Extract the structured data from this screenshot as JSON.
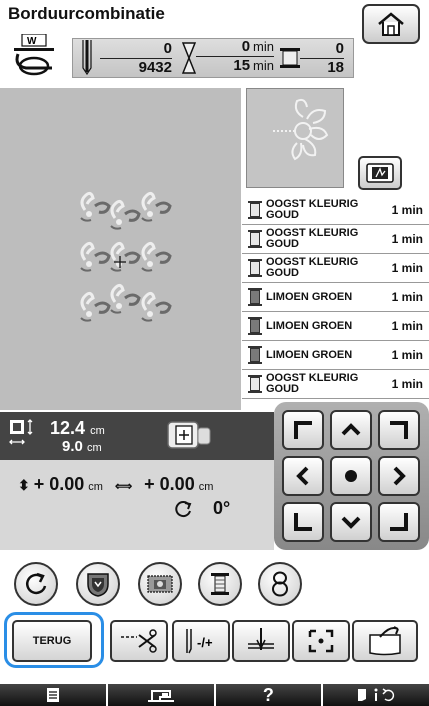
{
  "header": {
    "title": "Borduurcombinatie",
    "stitch_count": {
      "current": "0",
      "total": "9432"
    },
    "time": {
      "current": "0",
      "total": "15",
      "unit": "min"
    },
    "color_change": {
      "current": "0",
      "total": "18"
    }
  },
  "threads": [
    {
      "name": "OOGST KLEURIG GOUD",
      "time": "1 min",
      "color": "#e8e8e8"
    },
    {
      "name": "OOGST KLEURIG GOUD",
      "time": "1 min",
      "color": "#e8e8e8"
    },
    {
      "name": "OOGST KLEURIG GOUD",
      "time": "1 min",
      "color": "#e8e8e8"
    },
    {
      "name": "LIMOEN GROEN",
      "time": "1 min",
      "color": "#7a7a7a"
    },
    {
      "name": "LIMOEN GROEN",
      "time": "1 min",
      "color": "#7a7a7a"
    },
    {
      "name": "LIMOEN GROEN",
      "time": "1 min",
      "color": "#7a7a7a"
    },
    {
      "name": "OOGST KLEURIG GOUD",
      "time": "1 min",
      "color": "#e8e8e8"
    }
  ],
  "size": {
    "width": "12.4",
    "height": "9.0",
    "unit": "cm"
  },
  "offset": {
    "vertical": "+ 0.00",
    "horizontal": "+ 0.00",
    "unit": "cm"
  },
  "rotation": {
    "angle": "0°"
  },
  "buttons": {
    "back": "TERUG"
  },
  "icons": {
    "home": "home-icon",
    "view": "zoom-view-icon",
    "rotate": "rotate-icon",
    "border": "border-shield-icon",
    "density": "density-icon",
    "thread": "thread-spool-icon",
    "repeat": "repeat-8-icon",
    "cut": "thread-cut-icon",
    "tension": "tension-icon",
    "needle": "needle-position-icon",
    "trial": "trial-frame-icon",
    "pocket": "memory-pocket-icon"
  },
  "accent_color": "#2a8ee6"
}
